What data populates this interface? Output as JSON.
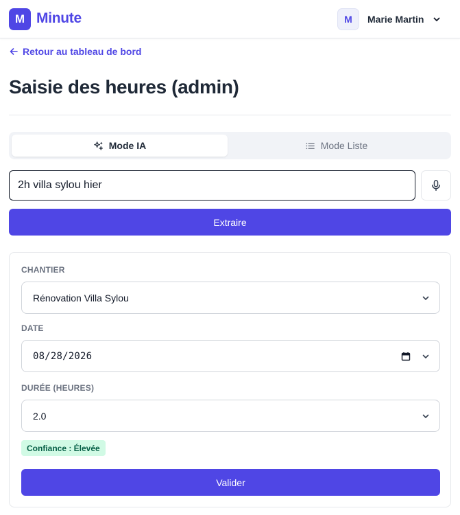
{
  "app": {
    "logo_letter": "M",
    "brand": "Minute",
    "accent_color": "#4f46e5"
  },
  "user": {
    "initial": "M",
    "name": "Marie Martin"
  },
  "nav": {
    "back_label": "Retour au tableau de bord"
  },
  "page": {
    "title": "Saisie des heures (admin)"
  },
  "tabs": [
    {
      "label": "Mode IA",
      "icon": "sparkles-icon",
      "active": true
    },
    {
      "label": "Mode Liste",
      "icon": "list-icon",
      "active": false
    }
  ],
  "ai_input": {
    "value": "2h villa sylou hier"
  },
  "extract_button": {
    "label": "Extraire"
  },
  "form": {
    "chantier": {
      "label": "CHANTIER",
      "value": "Rénovation Villa Sylou"
    },
    "date": {
      "label": "DATE",
      "value": "08/28/2026"
    },
    "duree": {
      "label": "DURÉE (HEURES)",
      "value": "2.0"
    },
    "confidence_badge": "Confiance : Élevée",
    "validate_button": "Valider"
  }
}
